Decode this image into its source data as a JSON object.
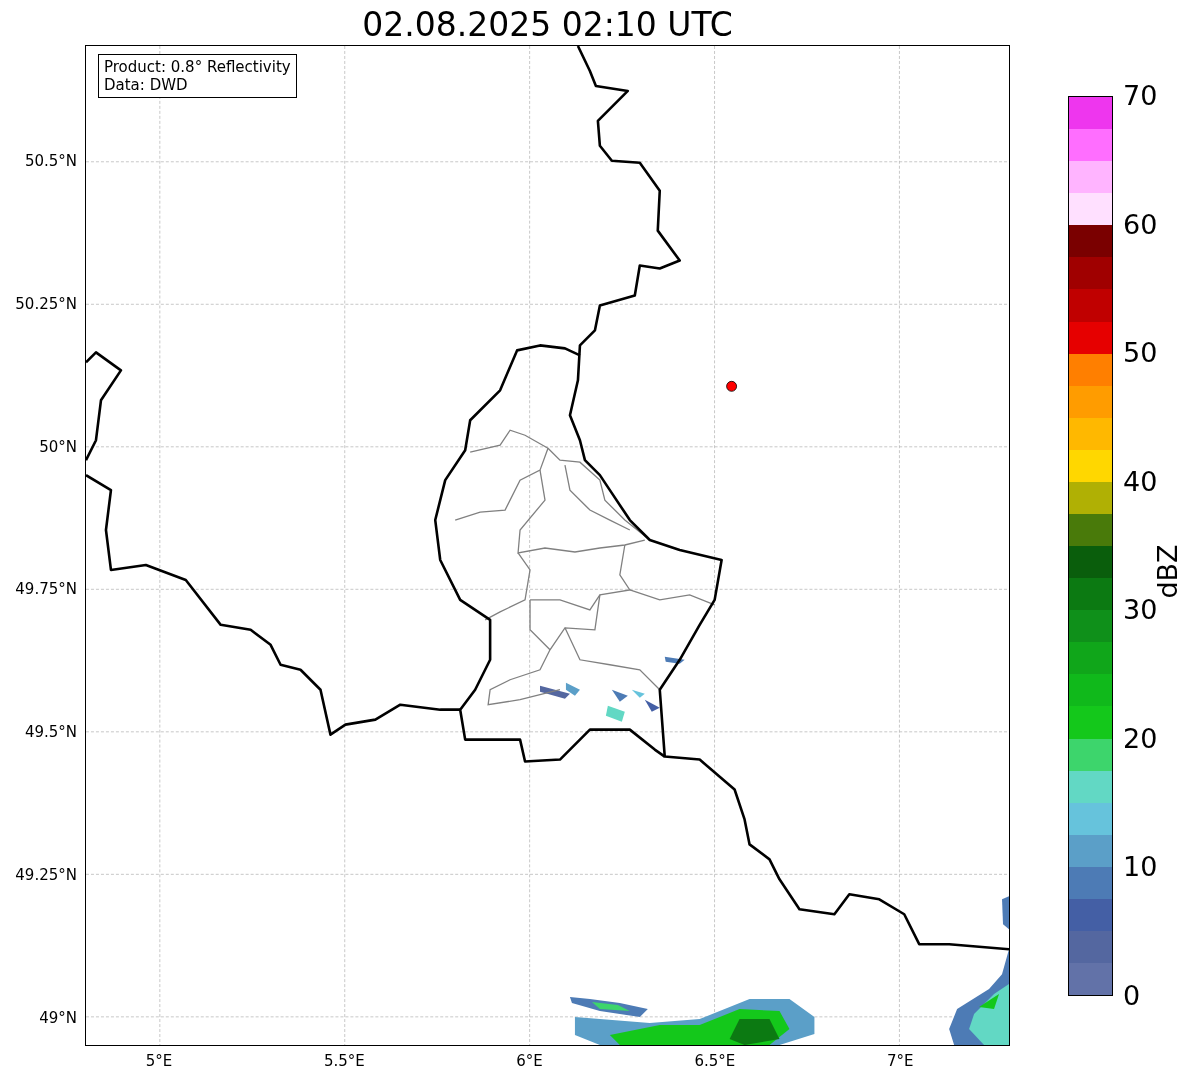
{
  "title": "02.08.2025 02:10 UTC",
  "annotation": [
    "Product: 0.8° Reflectivity",
    "Data: DWD"
  ],
  "map": {
    "lat_ticks": [
      "50.5°N",
      "50.25°N",
      "50°N",
      "49.75°N",
      "49.5°N",
      "49.25°N",
      "49°N"
    ],
    "lon_ticks": [
      "5°E",
      "5.5°E",
      "6°E",
      "6.5°E",
      "7°E"
    ]
  },
  "colorbar": {
    "label": "dBZ",
    "ticks": [
      "70",
      "60",
      "50",
      "40",
      "30",
      "20",
      "10",
      "0"
    ],
    "bins": [
      {
        "color": "#ee36ee"
      },
      {
        "color": "#ff6eff"
      },
      {
        "color": "#ffb4ff"
      },
      {
        "color": "#ffe0ff"
      },
      {
        "color": "#7a0000"
      },
      {
        "color": "#a00000"
      },
      {
        "color": "#c00000"
      },
      {
        "color": "#e60000"
      },
      {
        "color": "#ff7f00"
      },
      {
        "color": "#ff9c00"
      },
      {
        "color": "#ffb800"
      },
      {
        "color": "#ffd700"
      },
      {
        "color": "#b0b004"
      },
      {
        "color": "#497a0a"
      },
      {
        "color": "#0a5e0c"
      },
      {
        "color": "#0c7a12"
      },
      {
        "color": "#0f901a"
      },
      {
        "color": "#10a61a"
      },
      {
        "color": "#10b91b"
      },
      {
        "color": "#14c81b"
      },
      {
        "color": "#3dd56c"
      },
      {
        "color": "#62d8c4"
      },
      {
        "color": "#66c3dc"
      },
      {
        "color": "#5b9fc8"
      },
      {
        "color": "#4d7bb5"
      },
      {
        "color": "#445fa5"
      },
      {
        "color": "#5467a0"
      },
      {
        "color": "#6272a8"
      }
    ]
  }
}
